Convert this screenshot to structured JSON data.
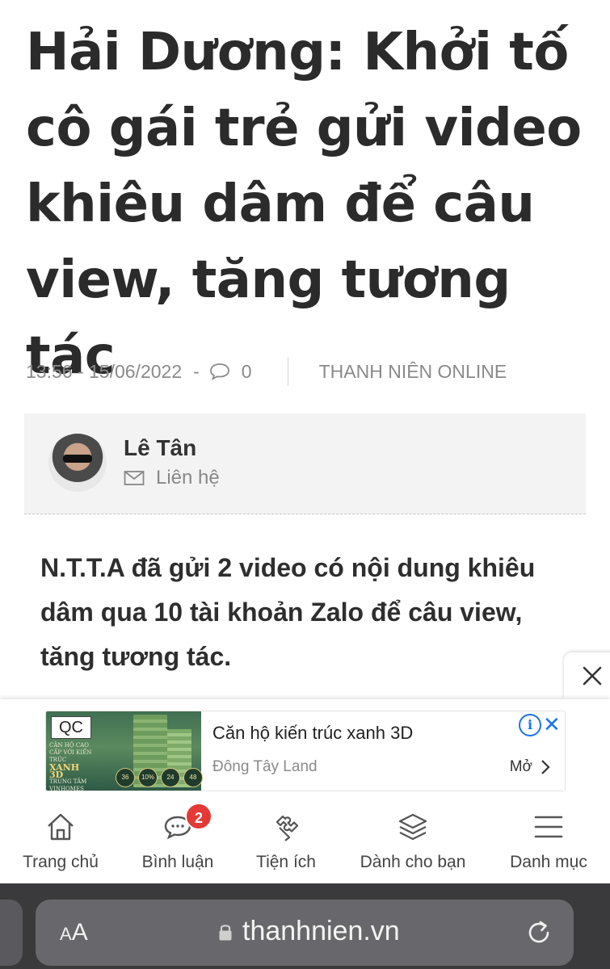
{
  "article": {
    "title": "Hải Dương: Khởi tố cô gái trẻ gửi video khiêu dâm để câu view, tăng tương tác",
    "timestamp": "13:56 - 15/06/2022",
    "separator": "-",
    "comment_count": "0",
    "source": "THANH NIÊN ONLINE",
    "author_name": "Lê Tân",
    "author_contact": "Liên hệ",
    "sapo": "N.T.T.A đã gửi 2 video có nội dung khiêu dâm qua 10 tài khoản Zalo để câu view, tăng tương tác."
  },
  "ad": {
    "qc_label": "QC",
    "image_caption": "CĂN HỘ CAO CẤP VỚI KIẾN TRÚC",
    "image_brand": "XANH 3D",
    "image_sub": "TRUNG TÂM VINHOMES GRAND PARK",
    "badges": [
      "36",
      "10%",
      "24",
      "48"
    ],
    "title": "Căn hộ kiến trúc xanh 3D",
    "advertiser": "Đông Tây Land",
    "open_label": "Mở",
    "info_label": "i"
  },
  "nav": {
    "items": [
      {
        "label": "Trang chủ",
        "icon": "home-icon"
      },
      {
        "label": "Bình luận",
        "icon": "comments-icon"
      },
      {
        "label": "Tiện ích",
        "icon": "puzzle-icon"
      },
      {
        "label": "Dành cho bạn",
        "icon": "layers-icon"
      },
      {
        "label": "Danh mục",
        "icon": "menu-icon"
      }
    ],
    "comment_badge": "2"
  },
  "browser": {
    "aa_large": "A",
    "aa_small": "A",
    "url": "thanhnien.vn"
  },
  "colors": {
    "badge": "#e53935",
    "ad_link": "#1a73e8",
    "browser_bar": "#3a3a3c"
  }
}
